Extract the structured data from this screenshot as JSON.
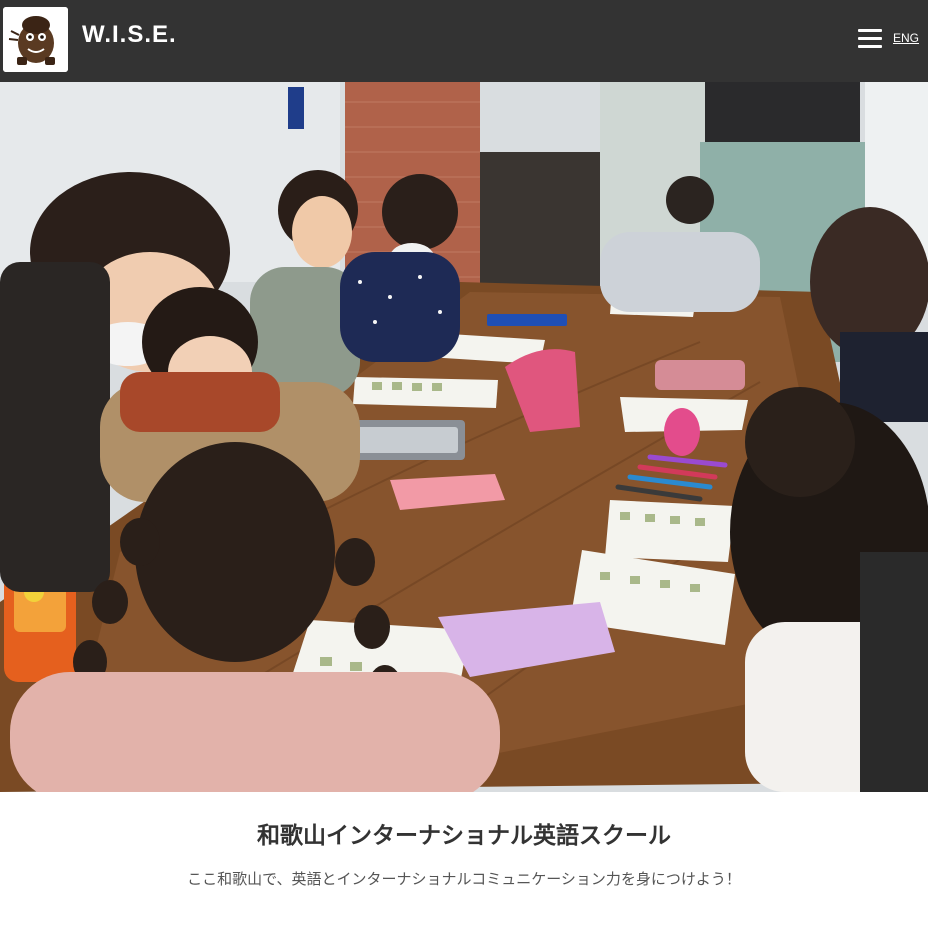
{
  "header": {
    "brand": "W.I.S.E.",
    "menu_icon": "hamburger-menu-icon",
    "language_link": "ENG",
    "background": "#333333"
  },
  "hero": {
    "image_subject": "classroom-photo",
    "table_color": "#7a4a24"
  },
  "content": {
    "title": "和歌山インターナショナル英語スクール",
    "subtitle": "ここ和歌山で、英語とインターナショナルコミュニケーション力を身につけよう！"
  }
}
